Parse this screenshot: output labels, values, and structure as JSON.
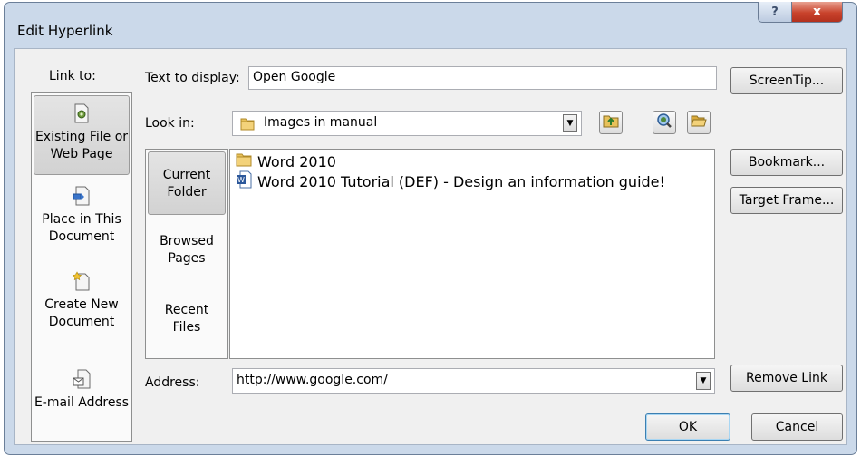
{
  "window": {
    "title": "Edit Hyperlink",
    "help_glyph": "?",
    "close_glyph": "x"
  },
  "link_to": {
    "header": "Link to:",
    "items": [
      {
        "label_line1": "Existing File or",
        "label_line2": "Web Page",
        "icon": "existing-file-icon",
        "selected": true
      },
      {
        "label_line1": "Place in This",
        "label_line2": "Document",
        "icon": "place-in-document-icon",
        "selected": false
      },
      {
        "label_line1": "Create New",
        "label_line2": "Document",
        "icon": "create-new-document-icon",
        "selected": false
      },
      {
        "label_line1": "E-mail Address",
        "label_line2": "",
        "icon": "email-address-icon",
        "selected": false
      }
    ]
  },
  "text_to_display": {
    "label": "Text to display:",
    "value": "Open Google"
  },
  "look_in": {
    "label": "Look in:",
    "value": "Images in manual",
    "arrow": "▼"
  },
  "places": [
    {
      "label_line1": "Current",
      "label_line2": "Folder",
      "selected": true
    },
    {
      "label_line1": "Browsed",
      "label_line2": "Pages",
      "selected": false
    },
    {
      "label_line1": "Recent",
      "label_line2": "Files",
      "selected": false
    }
  ],
  "files": [
    {
      "name": "Word 2010",
      "icon": "folder-icon"
    },
    {
      "name": "Word 2010 Tutorial (DEF) - Design an information guide!",
      "icon": "word-document-icon"
    }
  ],
  "address": {
    "label": "Address:",
    "value": "http://www.google.com/",
    "arrow": "▼"
  },
  "buttons": {
    "screentip": "ScreenTip...",
    "bookmark": "Bookmark...",
    "target_frame": "Target Frame...",
    "remove_link": "Remove Link",
    "ok": "OK",
    "cancel": "Cancel"
  }
}
